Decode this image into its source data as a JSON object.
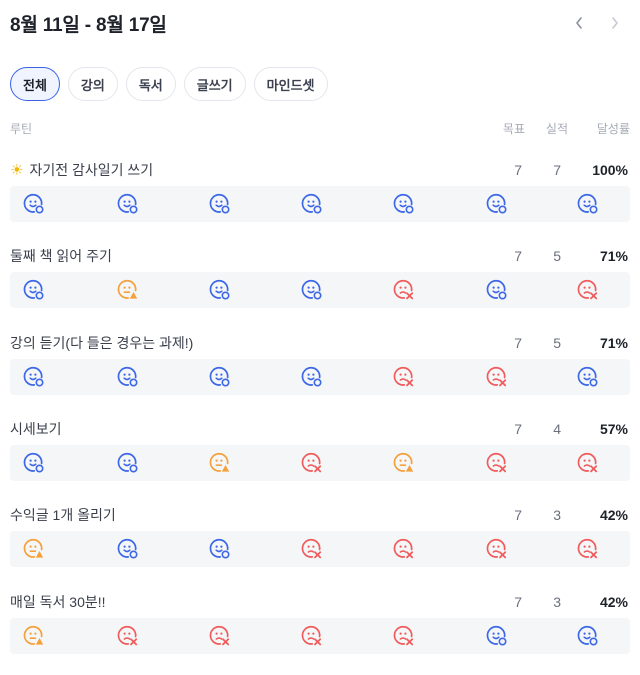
{
  "header": {
    "title": "8월 11일 - 8월 17일",
    "prev_icon": "chevron-left-icon",
    "next_icon": "chevron-right-icon"
  },
  "tabs": [
    {
      "label": "전체",
      "active": true
    },
    {
      "label": "강의",
      "active": false
    },
    {
      "label": "독서",
      "active": false
    },
    {
      "label": "글쓰기",
      "active": false
    },
    {
      "label": "마인드셋",
      "active": false
    }
  ],
  "columns": {
    "routine": "루틴",
    "goal": "목표",
    "actual": "실적",
    "rate": "달성률"
  },
  "colors": {
    "done": "#3b67e8",
    "partial": "#f5a03a",
    "missed": "#f15b5b",
    "accent": "#3a62e8"
  },
  "routines": [
    {
      "title": "자기전 감사일기 쓰기",
      "icon": "sun-icon",
      "goal": "7",
      "actual": "7",
      "rate": "100%",
      "days": [
        "done",
        "done",
        "done",
        "done",
        "done",
        "done",
        "done"
      ]
    },
    {
      "title": "둘째 책 읽어 주기",
      "goal": "7",
      "actual": "5",
      "rate": "71%",
      "days": [
        "done",
        "partial",
        "done",
        "done",
        "missed",
        "done",
        "missed"
      ]
    },
    {
      "title": "강의 듣기(다 들은 경우는 과제!)",
      "goal": "7",
      "actual": "5",
      "rate": "71%",
      "days": [
        "done",
        "done",
        "done",
        "done",
        "missed",
        "missed",
        "done"
      ]
    },
    {
      "title": "시세보기",
      "goal": "7",
      "actual": "4",
      "rate": "57%",
      "days": [
        "done",
        "done",
        "partial",
        "missed",
        "partial",
        "missed",
        "missed"
      ]
    },
    {
      "title": "수익글 1개 올리기",
      "goal": "7",
      "actual": "3",
      "rate": "42%",
      "days": [
        "partial",
        "done",
        "done",
        "missed",
        "missed",
        "missed",
        "missed"
      ]
    },
    {
      "title": "매일 독서 30분!!",
      "goal": "7",
      "actual": "3",
      "rate": "42%",
      "days": [
        "partial",
        "missed",
        "missed",
        "missed",
        "missed",
        "done",
        "done"
      ]
    }
  ]
}
